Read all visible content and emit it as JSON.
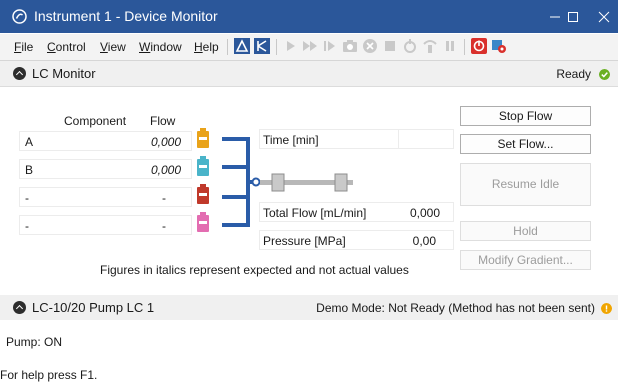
{
  "window": {
    "title": "Instrument 1 - Device Monitor"
  },
  "menu": [
    {
      "label": "File",
      "key": "F",
      "rest": "ile"
    },
    {
      "label": "Control",
      "key": "C",
      "rest": "ontrol"
    },
    {
      "label": "View",
      "key": "V",
      "rest": "iew"
    },
    {
      "label": "Window",
      "key": "W",
      "rest": "indow"
    },
    {
      "label": "Help",
      "key": "H",
      "rest": "elp"
    }
  ],
  "toolbar_icons": [
    "acquisition-icon",
    "batch-icon",
    "run-icon",
    "fast-forward-icon",
    "step-icon",
    "snapshot-icon",
    "stop-circle-icon",
    "stop-icon",
    "pump-icon",
    "valve-icon",
    "pause-icon",
    "emergency-stop-icon",
    "device-settings-icon"
  ],
  "lc_monitor": {
    "title": "LC Monitor",
    "status": "Ready",
    "status_color": "#6ab023",
    "col_component": "Component",
    "col_flow": "Flow",
    "rows": [
      {
        "component": "A",
        "flow": "0,000",
        "bottle_color": "#e9a31a"
      },
      {
        "component": "B",
        "flow": "0,000",
        "bottle_color": "#4ab4c9"
      },
      {
        "component": "-",
        "flow": "-",
        "bottle_color": "#c0392b"
      },
      {
        "component": "-",
        "flow": "-",
        "bottle_color": "#e36db1"
      }
    ],
    "time_label": "Time [min]",
    "time_value": "",
    "total_flow_label": "Total Flow [mL/min]",
    "total_flow_value": "0,000",
    "pressure_label": "Pressure [MPa]",
    "pressure_value": "0,00",
    "note": "Figures in italics represent expected and not actual values",
    "buttons": {
      "stop_flow": "Stop Flow",
      "set_flow": "Set Flow...",
      "resume_idle": "Resume Idle",
      "hold": "Hold",
      "modify_gradient": "Modify Gradient..."
    },
    "pipe_color": "#2a5ca8"
  },
  "pump": {
    "title": "LC-10/20 Pump LC 1",
    "status": "Demo Mode: Not Ready (Method has not been sent)",
    "status_color": "#f0a500",
    "state": "Pump: ON"
  },
  "statusbar": {
    "help": "For help press F1."
  }
}
